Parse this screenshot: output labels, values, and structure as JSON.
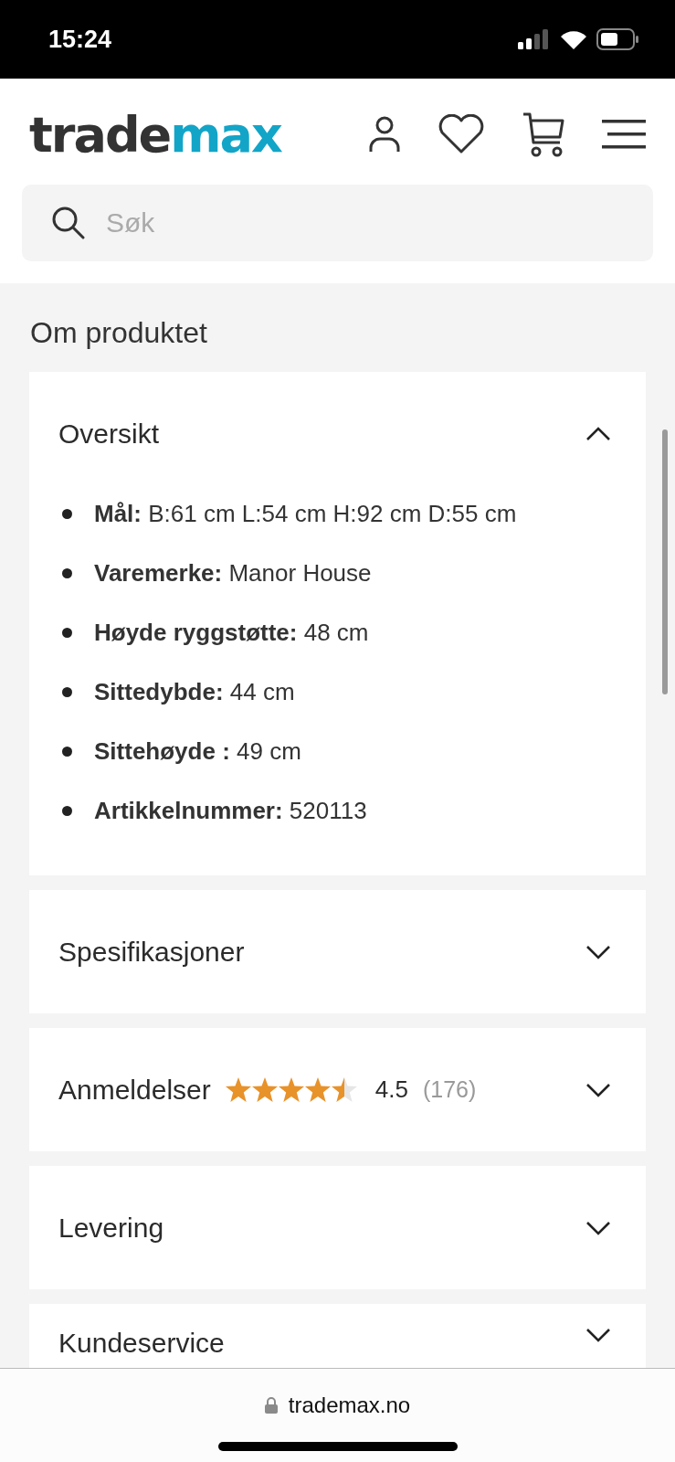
{
  "status_bar": {
    "time": "15:24"
  },
  "header": {
    "logo": {
      "dark": "trade",
      "accent": "max"
    },
    "search": {
      "placeholder": "Søk"
    }
  },
  "section_title": "Om produktet",
  "sections": [
    {
      "title": "Oversikt",
      "expanded": true,
      "items": [
        "**Mål:** B:61 cm L:54 cm H:92 cm D:55 cm",
        "**Varemerke:** Manor House",
        "**Høyde ryggstøtte:** 48 cm",
        "**Sittedybde:** 44 cm",
        "**Sittehøyde :** 49 cm",
        "**Artikkelnummer:** 520113"
      ]
    },
    {
      "title": "Spesifikasjoner",
      "expanded": false
    },
    {
      "title": "Anmeldelser",
      "expanded": false,
      "stars": 4.5,
      "rating": "4.5",
      "count": "(176)"
    },
    {
      "title": "Levering",
      "expanded": false
    },
    {
      "title": "Kundeservice",
      "expanded": false
    }
  ],
  "browser_bar": {
    "url": "trademax.no"
  }
}
